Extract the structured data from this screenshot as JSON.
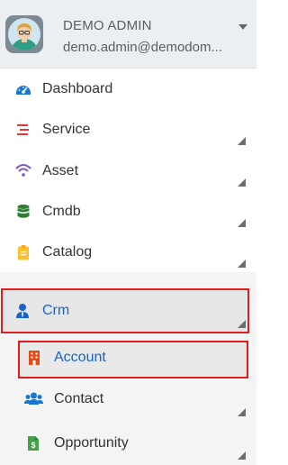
{
  "user": {
    "name": "DEMO ADMIN",
    "email": "demo.admin@demodom..."
  },
  "menu": [
    {
      "label": "Dashboard",
      "icon": "dashboard-gauge-icon",
      "color": "#1976d2"
    },
    {
      "label": "Service",
      "icon": "service-list-icon",
      "color": "#e53935"
    },
    {
      "label": "Asset",
      "icon": "wifi-icon",
      "color": "#7e57c2"
    },
    {
      "label": "Cmdb",
      "icon": "database-icon",
      "color": "#2e7d32"
    },
    {
      "label": "Catalog",
      "icon": "clipboard-icon",
      "color": "#fbc02d"
    }
  ],
  "crm": {
    "label": "Crm",
    "icon": "user-tie-icon",
    "color": "#1a63c7"
  },
  "submenu": [
    {
      "label": "Account",
      "icon": "building-icon",
      "color": "#e64a19"
    },
    {
      "label": "Contact",
      "icon": "users-icon",
      "color": "#1976d2"
    },
    {
      "label": "Opportunity",
      "icon": "dollar-document-icon",
      "color": "#43a047"
    }
  ],
  "colors": {
    "highlight_outline": "#e21c1c",
    "active_text": "#1a63c7",
    "header_bg": "#eceff1"
  }
}
